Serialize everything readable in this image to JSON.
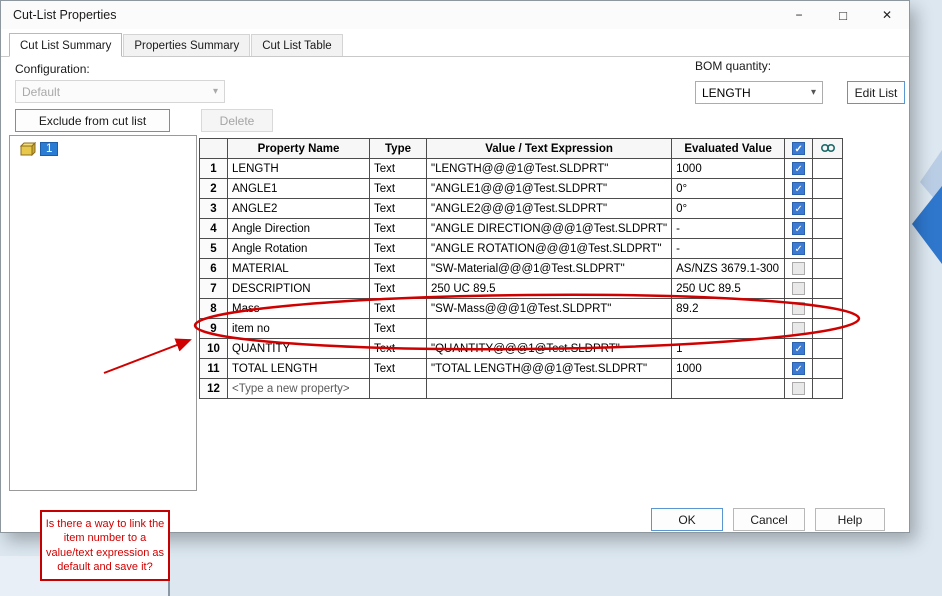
{
  "window": {
    "title": "Cut-List Properties",
    "minimize_icon": "−",
    "maximize_icon": "□",
    "close_icon": "✕"
  },
  "icons": {
    "chevron": "▾",
    "check": "✓"
  },
  "tabs": [
    {
      "label": "Cut List Summary",
      "active": true
    },
    {
      "label": "Properties Summary",
      "active": false
    },
    {
      "label": "Cut List Table",
      "active": false
    }
  ],
  "configuration": {
    "label": "Configuration:",
    "value": "Default"
  },
  "bom": {
    "label": "BOM quantity:",
    "value": "LENGTH",
    "edit_list_label": "Edit List"
  },
  "toolbar": {
    "exclude_label": "Exclude from cut list",
    "delete_label": "Delete"
  },
  "tree": {
    "item_label": "1"
  },
  "table": {
    "headers": [
      "Property Name",
      "Type",
      "Value / Text Expression",
      "Evaluated Value"
    ],
    "rows": [
      {
        "num": "1",
        "name": "LENGTH",
        "type": "Text",
        "expr": "\"LENGTH@@@1@Test.SLDPRT\"",
        "value": "1000",
        "checked": true
      },
      {
        "num": "2",
        "name": "ANGLE1",
        "type": "Text",
        "expr": "\"ANGLE1@@@1@Test.SLDPRT\"",
        "value": "0°",
        "checked": true
      },
      {
        "num": "3",
        "name": "ANGLE2",
        "type": "Text",
        "expr": "\"ANGLE2@@@1@Test.SLDPRT\"",
        "value": "0°",
        "checked": true
      },
      {
        "num": "4",
        "name": "Angle Direction",
        "type": "Text",
        "expr": "\"ANGLE DIRECTION@@@1@Test.SLDPRT\"",
        "value": "-",
        "checked": true
      },
      {
        "num": "5",
        "name": "Angle Rotation",
        "type": "Text",
        "expr": "\"ANGLE ROTATION@@@1@Test.SLDPRT\"",
        "value": "-",
        "checked": true
      },
      {
        "num": "6",
        "name": "MATERIAL",
        "type": "Text",
        "expr": "\"SW-Material@@@1@Test.SLDPRT\"",
        "value": "AS/NZS 3679.1-300",
        "checked": false
      },
      {
        "num": "7",
        "name": "DESCRIPTION",
        "type": "Text",
        "expr": "250 UC 89.5",
        "value": "250 UC 89.5",
        "checked": false
      },
      {
        "num": "8",
        "name": "Mass",
        "type": "Text",
        "expr": "\"SW-Mass@@@1@Test.SLDPRT\"",
        "value": "89.2",
        "checked": false
      },
      {
        "num": "9",
        "name": "item no",
        "type": "Text",
        "expr": "",
        "value": "",
        "checked": false
      },
      {
        "num": "10",
        "name": "QUANTITY",
        "type": "Text",
        "expr": "\"QUANTITY@@@1@Test.SLDPRT\"",
        "value": "1",
        "checked": true
      },
      {
        "num": "11",
        "name": "TOTAL LENGTH",
        "type": "Text",
        "expr": "\"TOTAL LENGTH@@@1@Test.SLDPRT\"",
        "value": "1000",
        "checked": true
      },
      {
        "num": "12",
        "name": "<Type a new property>",
        "type": "",
        "expr": "",
        "value": "",
        "checked": false,
        "placeholder": true
      }
    ]
  },
  "annotation": {
    "note": "Is there a way to link the item number to a value/text expression as default and save it?"
  },
  "footer": {
    "ok": "OK",
    "cancel": "Cancel",
    "help": "Help"
  }
}
